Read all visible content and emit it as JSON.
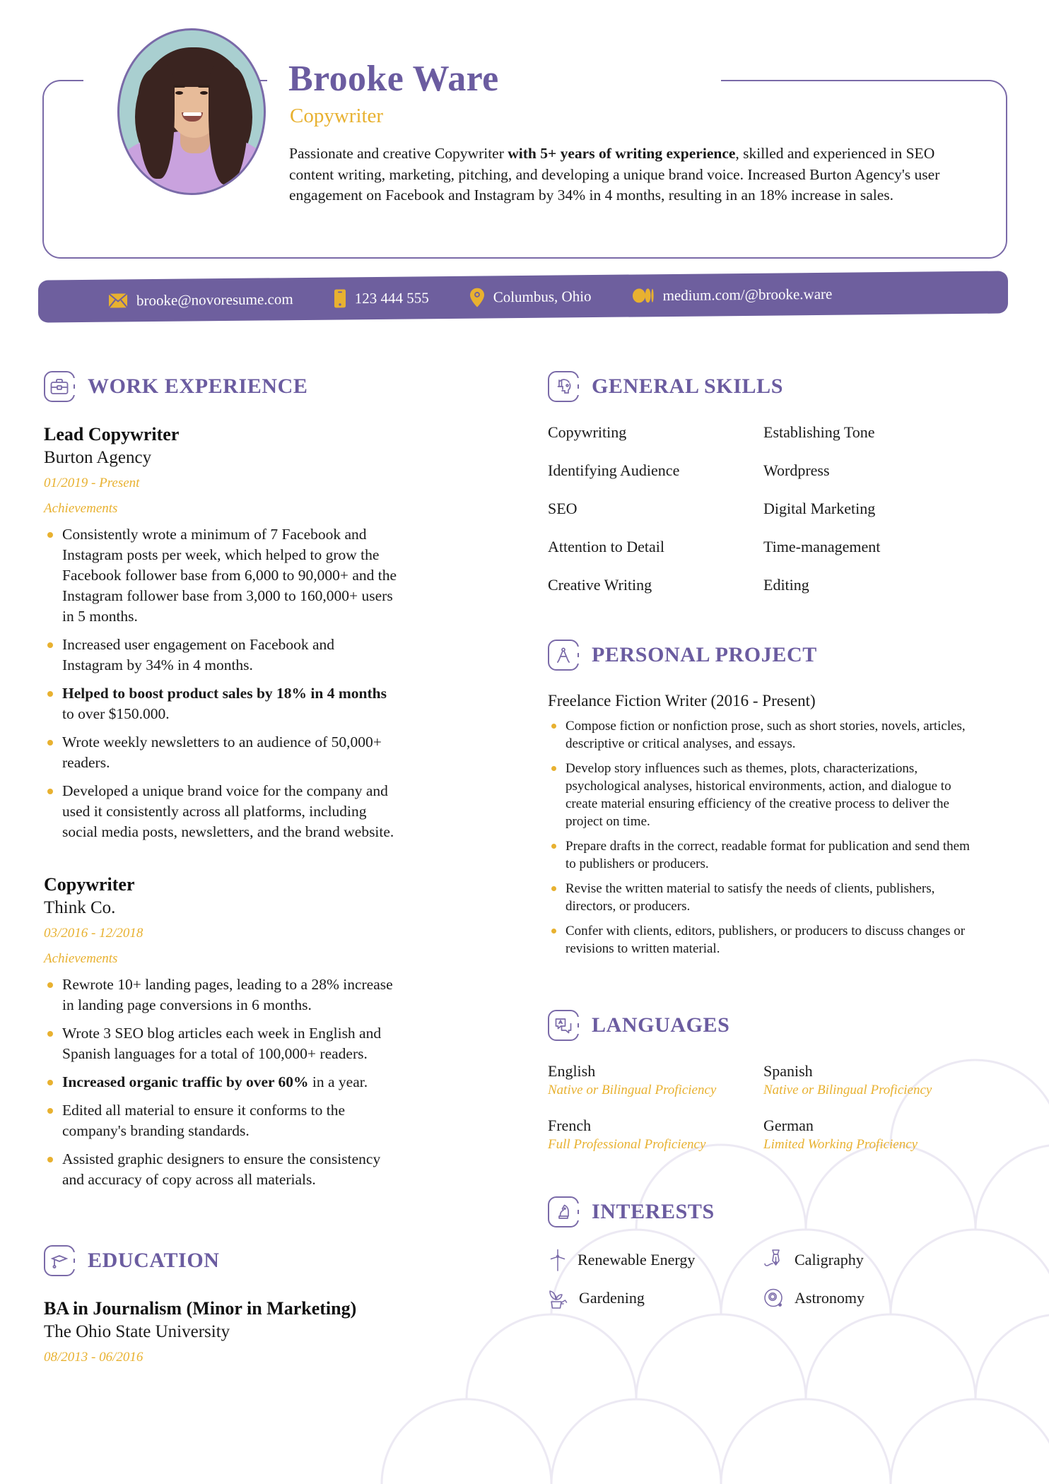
{
  "header": {
    "name": "Brooke Ware",
    "job_title": "Copywriter",
    "summary_part1": "Passionate and creative Copywriter ",
    "summary_bold": "with 5+ years of writing experience",
    "summary_part2": ", skilled and experienced in SEO content writing, marketing, pitching, and developing a unique brand voice. Increased Burton Agency's user engagement on Facebook and Instagram by 34% in 4 months, resulting in an 18% increase in sales.",
    "avatar": "portrait-photo"
  },
  "contact": {
    "email": "brooke@novoresume.com",
    "phone": "123 444 555",
    "location": "Columbus, Ohio",
    "website": "medium.com/@brooke.ware",
    "icons": {
      "email": "envelope-icon",
      "phone": "mobile-phone-icon",
      "location": "map-pin-icon",
      "website": "medium-logo-icon"
    }
  },
  "colors": {
    "purple": "#6b5ca0",
    "purple_bar": "#6e5f9e",
    "purple_line": "#7a6aa8",
    "gold": "#e8b130",
    "text": "#1a1a1a"
  },
  "sections": {
    "work_experience": {
      "title": "WORK EXPERIENCE",
      "icon": "briefcase-icon",
      "entries": [
        {
          "role": "Lead Copywriter",
          "org": "Burton Agency",
          "dates": "01/2019 - Present",
          "achievements_label": "Achievements",
          "bullets": [
            {
              "text": "Consistently wrote a minimum of 7 Facebook and Instagram posts per week, which helped to grow the Facebook follower base from 6,000 to 90,000+ and the Instagram follower base from 3,000 to 160,000+ users in 5 months."
            },
            {
              "text": "Increased user engagement on Facebook and Instagram by 34% in 4 months."
            },
            {
              "bold": "Helped to boost product sales by 18% in 4 months",
              "text": " to over $150.000."
            },
            {
              "text": "Wrote weekly newsletters to an audience of 50,000+ readers."
            },
            {
              "text": "Developed a unique brand voice for the company and used it consistently across all platforms, including social media posts, newsletters, and the brand website."
            }
          ]
        },
        {
          "role": "Copywriter",
          "org": "Think Co.",
          "dates": "03/2016 - 12/2018",
          "achievements_label": "Achievements",
          "bullets": [
            {
              "text": "Rewrote 10+ landing pages, leading to a 28% increase in landing page conversions in 6 months."
            },
            {
              "text": "Wrote 3 SEO blog articles each week in English and Spanish languages for a total of 100,000+ readers."
            },
            {
              "bold": "Increased organic traffic by over 60%",
              "text": " in a year."
            },
            {
              "text": "Edited all material to ensure it conforms to the company's branding standards."
            },
            {
              "text": "Assisted graphic designers to ensure the consistency and accuracy of copy across all materials."
            }
          ]
        }
      ]
    },
    "education": {
      "title": "EDUCATION",
      "icon": "graduation-cap-icon",
      "entries": [
        {
          "degree": "BA in Journalism (Minor in Marketing)",
          "school": "The Ohio State University",
          "dates": "08/2013 - 06/2016"
        }
      ]
    },
    "general_skills": {
      "title": "GENERAL SKILLS",
      "icon": "head-gears-icon",
      "items": [
        "Copywriting",
        "Establishing Tone",
        "Identifying Audience",
        "Wordpress",
        "SEO",
        "Digital Marketing",
        "Attention to Detail",
        "Time-management",
        "Creative Writing",
        "Editing"
      ]
    },
    "personal_project": {
      "title": "PERSONAL PROJECT",
      "icon": "compass-divider-icon",
      "project_title": "Freelance Fiction Writer (2016 - Present)",
      "bullets": [
        "Compose fiction or nonfiction prose, such as short stories, novels, articles, descriptive or critical analyses, and essays.",
        "Develop story influences such as themes, plots, characterizations, psychological analyses, historical environments, action, and dialogue to create material ensuring efficiency of the creative process to deliver the project on time.",
        "Prepare drafts in the correct, readable format for publication and send them to publishers or producers.",
        "Revise the written material to satisfy the needs of clients, publishers, directors, or producers.",
        "Confer with clients, editors, publishers, or producers to discuss changes or revisions to written material."
      ]
    },
    "languages": {
      "title": "LANGUAGES",
      "icon": "translate-icon",
      "items": [
        {
          "name": "English",
          "level": "Native or Bilingual Proficiency"
        },
        {
          "name": "Spanish",
          "level": "Native or Bilingual Proficiency"
        },
        {
          "name": "French",
          "level": "Full Professional Proficiency"
        },
        {
          "name": "German",
          "level": "Limited Working Proficiency"
        }
      ]
    },
    "interests": {
      "title": "INTERESTS",
      "icon": "chess-knight-icon",
      "items": [
        {
          "label": "Renewable Energy",
          "icon": "wind-turbine-icon"
        },
        {
          "label": "Caligraphy",
          "icon": "fountain-pen-icon"
        },
        {
          "label": "Gardening",
          "icon": "plant-watering-can-icon"
        },
        {
          "label": "Astronomy",
          "icon": "orbit-planet-icon"
        }
      ]
    }
  }
}
